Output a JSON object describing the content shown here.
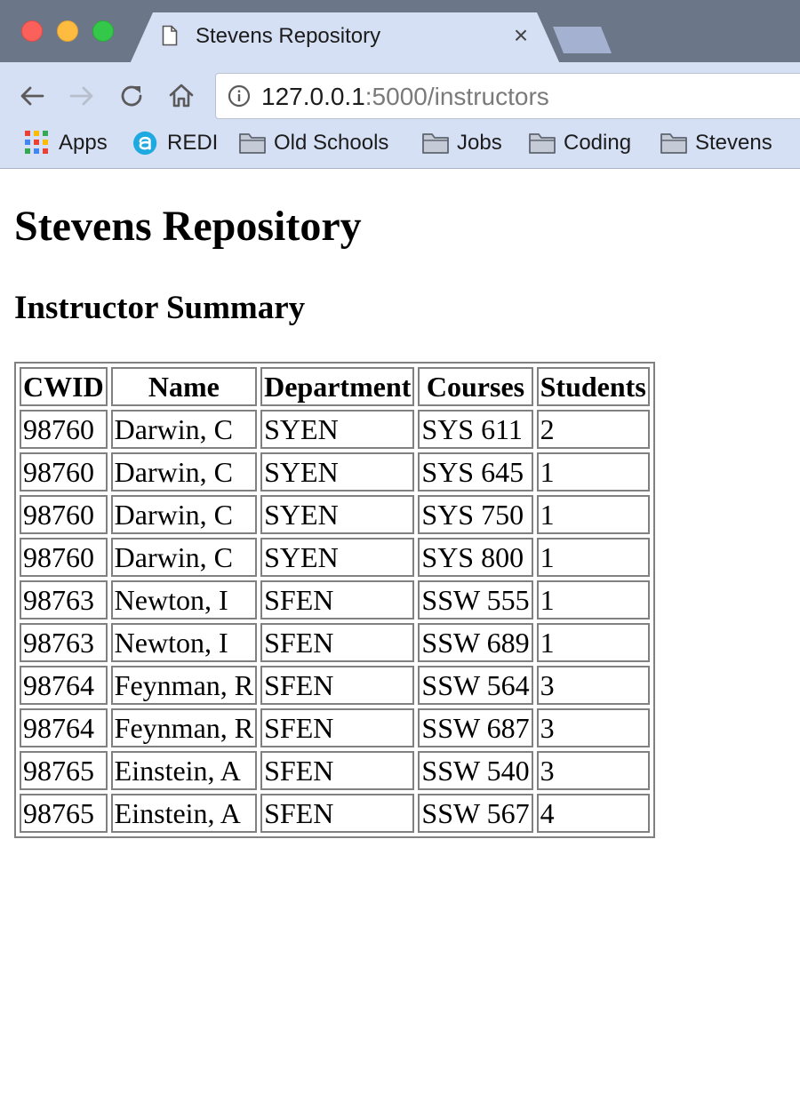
{
  "browser": {
    "tab_title": "Stevens Repository",
    "tab_close_glyph": "×",
    "url_host": "127.0.0.1",
    "url_rest": ":5000/instructors",
    "bookmarks": [
      {
        "label": "Apps",
        "icon": "apps-grid-icon"
      },
      {
        "label": "REDI",
        "icon": "redi-logo-icon"
      },
      {
        "label": "Old Schools",
        "icon": "folder-icon"
      },
      {
        "label": "Jobs",
        "icon": "folder-icon"
      },
      {
        "label": "Coding",
        "icon": "folder-icon"
      },
      {
        "label": "Stevens",
        "icon": "folder-icon"
      }
    ]
  },
  "page": {
    "heading": "Stevens Repository",
    "subheading": "Instructor Summary",
    "table": {
      "headers": [
        "CWID",
        "Name",
        "Department",
        "Courses",
        "Students"
      ],
      "rows": [
        [
          "98760",
          "Darwin, C",
          "SYEN",
          "SYS 611",
          "2"
        ],
        [
          "98760",
          "Darwin, C",
          "SYEN",
          "SYS 645",
          "1"
        ],
        [
          "98760",
          "Darwin, C",
          "SYEN",
          "SYS 750",
          "1"
        ],
        [
          "98760",
          "Darwin, C",
          "SYEN",
          "SYS 800",
          "1"
        ],
        [
          "98763",
          "Newton, I",
          "SFEN",
          "SSW 555",
          "1"
        ],
        [
          "98763",
          "Newton, I",
          "SFEN",
          "SSW 689",
          "1"
        ],
        [
          "98764",
          "Feynman, R",
          "SFEN",
          "SSW 564",
          "3"
        ],
        [
          "98764",
          "Feynman, R",
          "SFEN",
          "SSW 687",
          "3"
        ],
        [
          "98765",
          "Einstein, A",
          "SFEN",
          "SSW 540",
          "3"
        ],
        [
          "98765",
          "Einstein, A",
          "SFEN",
          "SSW 567",
          "4"
        ]
      ]
    }
  },
  "colors": {
    "tabstrip": "#6b7789",
    "toolbar": "#d6e0f4",
    "table_border": "#808080"
  }
}
